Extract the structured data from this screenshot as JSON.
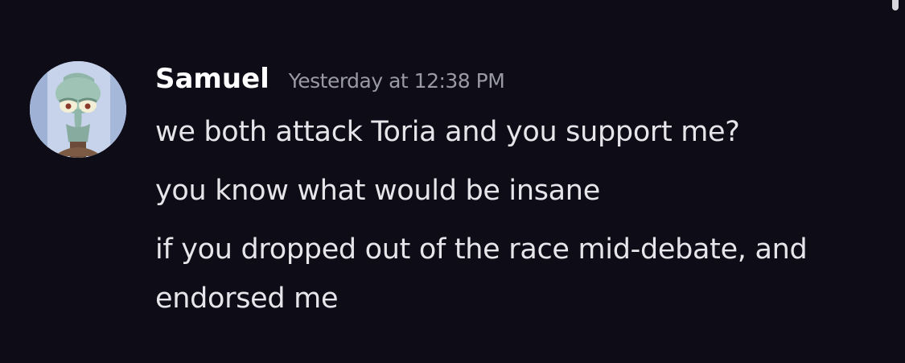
{
  "message": {
    "author": "Samuel",
    "timestamp": "Yesterday at 12:38 PM",
    "avatar_icon": "squidward-avatar-icon",
    "lines": [
      "we both attack Toria and you support me?",
      "you know what would be insane",
      "if you dropped out of the race mid-debate, and endorsed me"
    ]
  },
  "colors": {
    "background": "#0d0c17",
    "username": "#ffffff",
    "timestamp": "#9a9aa6",
    "text": "#e6e6ea"
  }
}
